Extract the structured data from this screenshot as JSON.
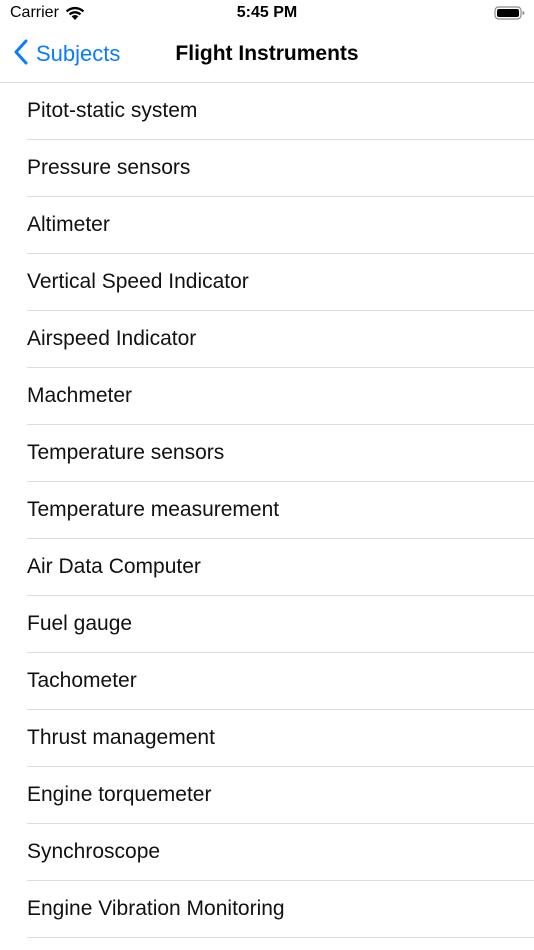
{
  "status_bar": {
    "carrier": "Carrier",
    "time": "5:45 PM",
    "wifi_icon": "wifi-icon",
    "battery_icon": "battery-icon"
  },
  "nav": {
    "back_label": "Subjects",
    "back_icon": "chevron-left-icon",
    "title": "Flight Instruments",
    "accent_color": "#0a7cff"
  },
  "items": [
    {
      "label": "Pitot-static system"
    },
    {
      "label": "Pressure sensors"
    },
    {
      "label": "Altimeter"
    },
    {
      "label": "Vertical Speed Indicator"
    },
    {
      "label": "Airspeed Indicator"
    },
    {
      "label": "Machmeter"
    },
    {
      "label": "Temperature sensors"
    },
    {
      "label": "Temperature measurement"
    },
    {
      "label": "Air Data Computer"
    },
    {
      "label": "Fuel gauge"
    },
    {
      "label": "Tachometer"
    },
    {
      "label": "Thrust management"
    },
    {
      "label": "Engine torquemeter"
    },
    {
      "label": "Synchroscope"
    },
    {
      "label": "Engine Vibration Monitoring"
    }
  ]
}
